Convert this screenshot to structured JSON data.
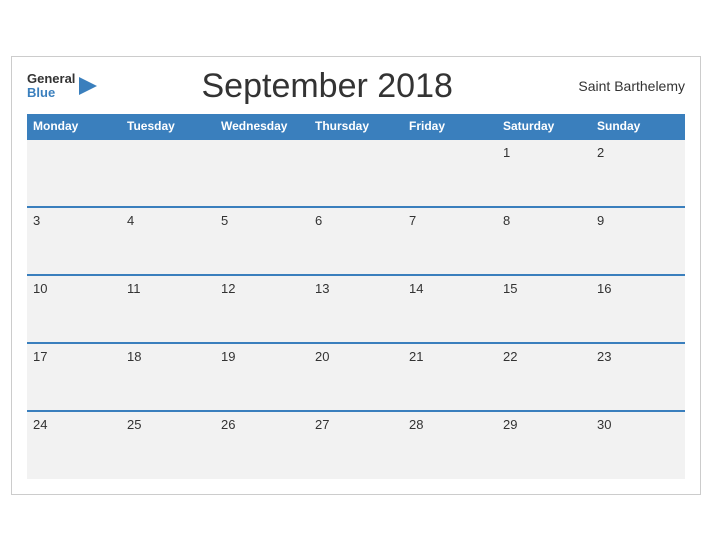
{
  "header": {
    "logo_general": "General",
    "logo_blue": "Blue",
    "title": "September 2018",
    "region": "Saint Barthelemy"
  },
  "days_of_week": [
    "Monday",
    "Tuesday",
    "Wednesday",
    "Thursday",
    "Friday",
    "Saturday",
    "Sunday"
  ],
  "weeks": [
    [
      "",
      "",
      "",
      "",
      "",
      "1",
      "2"
    ],
    [
      "3",
      "4",
      "5",
      "6",
      "7",
      "8",
      "9"
    ],
    [
      "10",
      "11",
      "12",
      "13",
      "14",
      "15",
      "16"
    ],
    [
      "17",
      "18",
      "19",
      "20",
      "21",
      "22",
      "23"
    ],
    [
      "24",
      "25",
      "26",
      "27",
      "28",
      "29",
      "30"
    ]
  ]
}
